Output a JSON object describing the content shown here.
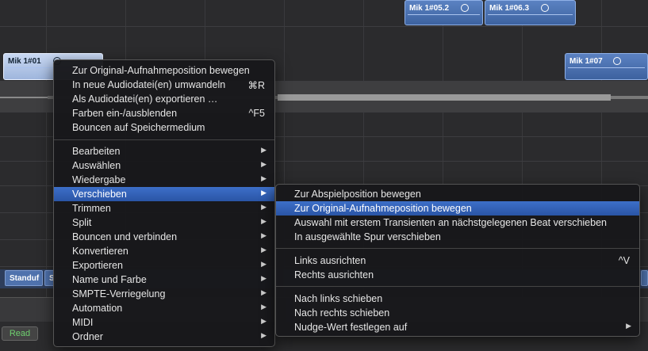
{
  "regions": {
    "r1": {
      "name": "Mik 1#01"
    },
    "r2": {
      "name": "Mik 1#05.2"
    },
    "r3": {
      "name": "Mik 1#06.3"
    },
    "r4": {
      "name": "Mik 1#07"
    }
  },
  "lane": {
    "tag1": "Standuf",
    "tag2": "S"
  },
  "automation": {
    "read_label": "Read"
  },
  "context_menu": {
    "group1": [
      {
        "label": "Zur Original-Aufnahmeposition bewegen",
        "shortcut": ""
      },
      {
        "label": "In neue Audiodatei(en) umwandeln",
        "shortcut": "⌘R"
      },
      {
        "label": "Als Audiodatei(en) exportieren …",
        "shortcut": ""
      },
      {
        "label": "Farben ein-/ausblenden",
        "shortcut": "^F5"
      },
      {
        "label": "Bouncen auf Speichermedium",
        "shortcut": ""
      }
    ],
    "group2": [
      {
        "label": "Bearbeiten"
      },
      {
        "label": "Auswählen"
      },
      {
        "label": "Wiedergabe"
      },
      {
        "label": "Verschieben"
      },
      {
        "label": "Trimmen"
      },
      {
        "label": "Split"
      },
      {
        "label": "Bouncen und verbinden"
      },
      {
        "label": "Konvertieren"
      },
      {
        "label": "Exportieren"
      },
      {
        "label": "Name und Farbe"
      },
      {
        "label": "SMPTE-Verriegelung"
      },
      {
        "label": "Automation"
      },
      {
        "label": "MIDI"
      },
      {
        "label": "Ordner"
      }
    ],
    "highlighted": "Verschieben"
  },
  "submenu": {
    "group1": [
      {
        "label": "Zur Abspielposition bewegen"
      },
      {
        "label": "Zur Original-Aufnahmeposition bewegen"
      },
      {
        "label": "Auswahl mit erstem Transienten an nächstgelegenen Beat verschieben"
      },
      {
        "label": "In ausgewählte Spur verschieben"
      }
    ],
    "group2": [
      {
        "label": "Links ausrichten",
        "shortcut": "^V"
      },
      {
        "label": "Rechts ausrichten",
        "shortcut": ""
      }
    ],
    "group3": [
      {
        "label": "Nach links schieben"
      },
      {
        "label": "Nach rechts schieben"
      },
      {
        "label": "Nudge-Wert festlegen auf"
      }
    ],
    "highlighted": "Zur Original-Aufnahmeposition bewegen"
  }
}
